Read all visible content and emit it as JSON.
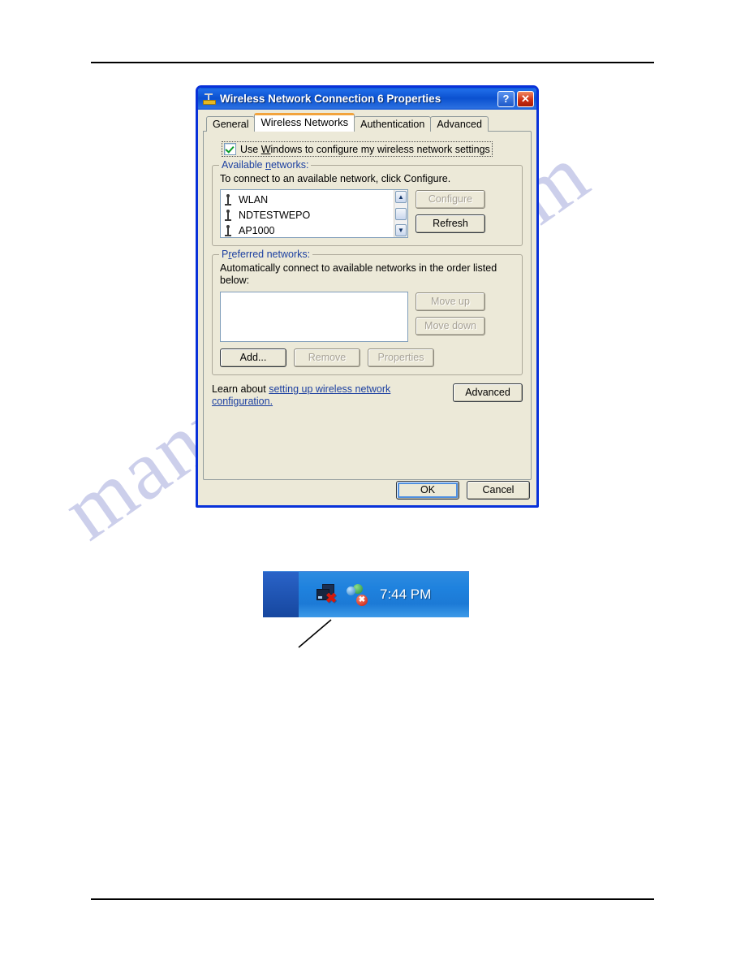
{
  "document": {
    "watermark": "manualshive.com"
  },
  "dialog": {
    "title": "Wireless Network Connection 6 Properties",
    "title_icon": "network-adapter-icon",
    "help_button": "?",
    "close_button": "✕",
    "tabs": [
      {
        "label": "General",
        "active": false
      },
      {
        "label": "Wireless Networks",
        "active": true
      },
      {
        "label": "Authentication",
        "active": false
      },
      {
        "label": "Advanced",
        "active": false
      }
    ],
    "use_windows_checkbox": {
      "label_before": "Use ",
      "label_accel": "W",
      "label_after": "indows to configure my wireless network settings",
      "checked": true
    },
    "available_networks": {
      "group_title_before": "Available ",
      "group_title_accel": "n",
      "group_title_after": "etworks:",
      "hint": "To connect to an available network, click Configure.",
      "items": [
        {
          "name": "WLAN",
          "icon": "wireless-network-icon"
        },
        {
          "name": "NDTESTWEPO",
          "icon": "wireless-network-icon"
        },
        {
          "name": "AP1000",
          "icon": "wireless-network-icon"
        }
      ],
      "scroll_up": "▲",
      "scroll_down": "▼",
      "configure_button": {
        "label": "Configure",
        "enabled": false
      },
      "refresh_button": {
        "label": "Refresh",
        "enabled": true
      }
    },
    "preferred_networks": {
      "group_title_before": "P",
      "group_title_accel": "r",
      "group_title_after": "eferred networks:",
      "hint": "Automatically connect to available networks in the order listed below:",
      "items": [],
      "move_up_button": {
        "label": "Move up",
        "enabled": false
      },
      "move_down_button": {
        "label": "Move down",
        "enabled": false
      },
      "add_button": {
        "label": "Add...",
        "enabled": true
      },
      "remove_button": {
        "label": "Remove",
        "enabled": false
      },
      "properties_button": {
        "label": "Properties",
        "enabled": false
      }
    },
    "learn": {
      "prefix": "Learn about ",
      "link": "setting up wireless network configuration."
    },
    "advanced_button": "Advanced",
    "ok_button": "OK",
    "cancel_button": "Cancel"
  },
  "systray": {
    "time": "7:44 PM",
    "icons": [
      {
        "name": "network-disconnected-icon",
        "badge": "error"
      },
      {
        "name": "network-users-error-icon",
        "badge": "error"
      }
    ]
  },
  "colors": {
    "title_bar": "#0b51d0",
    "dialog_border": "#0831d9",
    "dialog_face": "#ece9d8",
    "group_label": "#1b3fa0",
    "link": "#1b3fa0",
    "active_tab_accent": "#f2a33c",
    "close_button": "#cf3014",
    "watermark": "#b9bde4",
    "tray_background": "#1f82de"
  }
}
